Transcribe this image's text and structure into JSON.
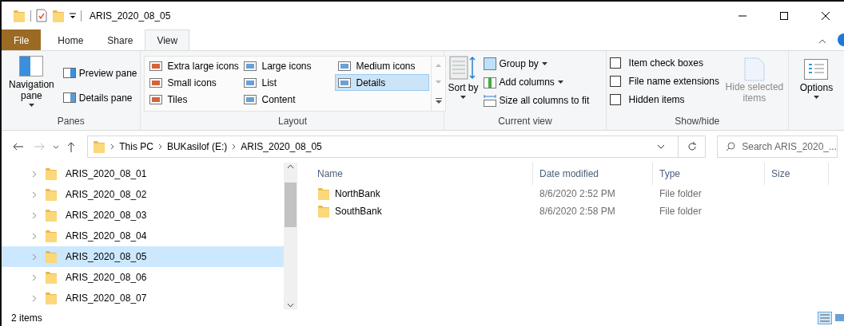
{
  "window": {
    "title": "ARIS_2020_08_05"
  },
  "ribbon_tabs": [
    {
      "label": "File",
      "kind": "file",
      "selected": false
    },
    {
      "label": "Home",
      "kind": "tab",
      "selected": false
    },
    {
      "label": "Share",
      "kind": "tab",
      "selected": false
    },
    {
      "label": "View",
      "kind": "tab",
      "selected": true
    }
  ],
  "panes_group": {
    "label": "Panes",
    "navigation_pane": "Navigation pane",
    "preview_pane": "Preview pane",
    "details_pane": "Details pane"
  },
  "layout_group": {
    "label": "Layout",
    "options": [
      {
        "label": "Extra large icons",
        "selected": false
      },
      {
        "label": "Large icons",
        "selected": false
      },
      {
        "label": "Medium icons",
        "selected": false
      },
      {
        "label": "Small icons",
        "selected": false
      },
      {
        "label": "List",
        "selected": false
      },
      {
        "label": "Details",
        "selected": true
      },
      {
        "label": "Tiles",
        "selected": false
      },
      {
        "label": "Content",
        "selected": false
      }
    ]
  },
  "current_view_group": {
    "label": "Current view",
    "sort_by": "Sort by",
    "group_by": "Group by",
    "add_columns": "Add columns",
    "size_columns": "Size all columns to fit"
  },
  "show_hide_group": {
    "label": "Show/hide",
    "checkboxes": [
      {
        "label": "Item check boxes",
        "checked": false
      },
      {
        "label": "File name extensions",
        "checked": false
      },
      {
        "label": "Hidden items",
        "checked": false
      }
    ],
    "hide_selected": "Hide selected items"
  },
  "options_button": "Options",
  "address_bar": {
    "path": [
      "This PC",
      "BUKasilof (E:)",
      "ARIS_2020_08_05"
    ],
    "search_placeholder": "Search ARIS_2020_..."
  },
  "navigation_tree": [
    {
      "label": "ARIS_2020_08_01",
      "selected": false
    },
    {
      "label": "ARIS_2020_08_02",
      "selected": false
    },
    {
      "label": "ARIS_2020_08_03",
      "selected": false
    },
    {
      "label": "ARIS_2020_08_04",
      "selected": false
    },
    {
      "label": "ARIS_2020_08_05",
      "selected": true
    },
    {
      "label": "ARIS_2020_08_06",
      "selected": false
    },
    {
      "label": "ARIS_2020_08_07",
      "selected": false
    }
  ],
  "file_list": {
    "columns": [
      "Name",
      "Date modified",
      "Type",
      "Size"
    ],
    "rows": [
      {
        "name": "NorthBank",
        "date_modified": "8/6/2020 2:52 PM",
        "type": "File folder"
      },
      {
        "name": "SouthBank",
        "date_modified": "8/6/2020 2:58 PM",
        "type": "File folder"
      }
    ]
  },
  "status_bar": {
    "count": "2 items"
  }
}
